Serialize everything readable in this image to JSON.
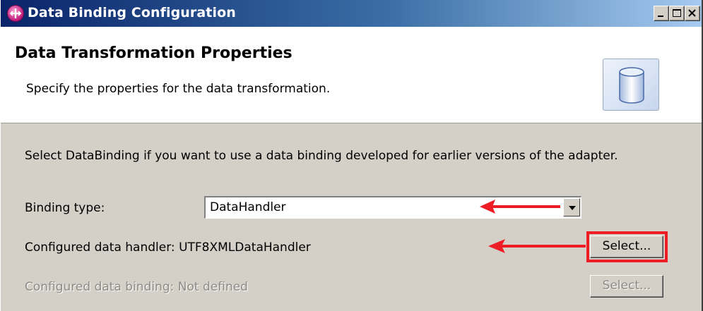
{
  "window": {
    "title": "Data Binding Configuration",
    "icon": "wizard-app-icon"
  },
  "header": {
    "title": "Data Transformation Properties",
    "description": "Specify the properties for the data transformation.",
    "image_icon": "cylinder-icon"
  },
  "body": {
    "intro": "Select DataBinding if you want to use a data binding developed for earlier versions of the adapter.",
    "binding_type": {
      "label": "Binding type:",
      "value": "DataHandler"
    },
    "configured_data_handler": {
      "label": "Configured data handler:",
      "value": "UTF8XMLDataHandler",
      "button_label": "Select..."
    },
    "configured_data_binding": {
      "label": "Configured data binding:",
      "value": "Not defined",
      "button_label": "Select..."
    }
  },
  "annotations": {
    "highlight_color": "#ee1c25"
  }
}
